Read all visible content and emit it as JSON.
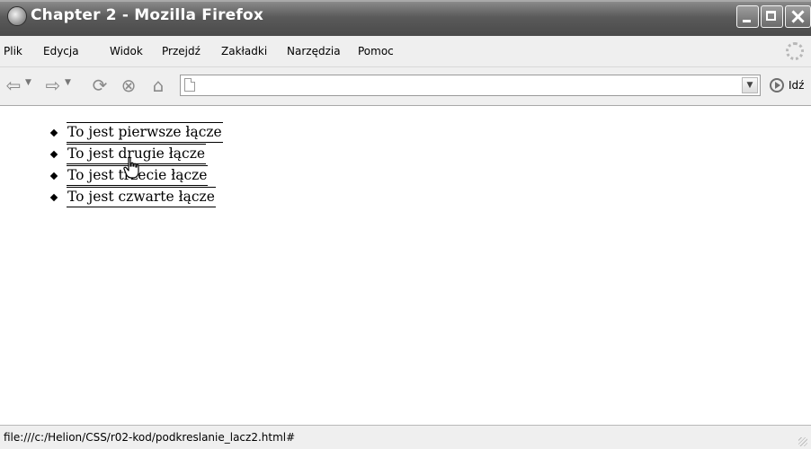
{
  "window": {
    "title": "Chapter 2 - Mozilla Firefox"
  },
  "menu": {
    "items": [
      {
        "label": "Plik"
      },
      {
        "label": "Edycja"
      },
      {
        "label": "Widok"
      },
      {
        "label": "Przejdź"
      },
      {
        "label": "Zakładki"
      },
      {
        "label": "Narzędzia"
      },
      {
        "label": "Pomoc"
      }
    ]
  },
  "toolbar": {
    "go_label": "Idź",
    "url_value": "",
    "icons": [
      "back-arrow-icon",
      "forward-arrow-icon",
      "reload-icon",
      "stop-icon",
      "home-icon",
      "go-icon"
    ]
  },
  "content": {
    "links": [
      {
        "text": "To jest pierwsze łącze"
      },
      {
        "text": "To jest drugie łącze"
      },
      {
        "text": "To jest trzecie łącze"
      },
      {
        "text": "To jest czwarte łącze"
      }
    ]
  },
  "statusbar": {
    "text": "file:///c:/Helion/CSS/r02-kod/podkreslanie_lacz2.html#"
  }
}
